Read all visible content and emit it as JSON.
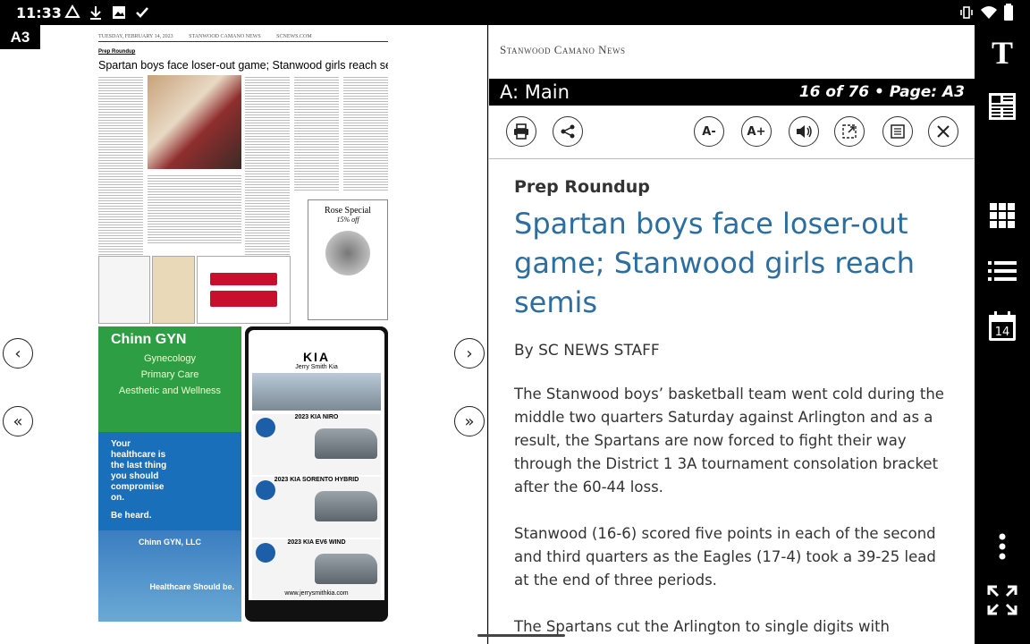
{
  "status_bar": {
    "time": "11:33"
  },
  "left_pane": {
    "page_badge": "A3",
    "paper": {
      "masthead_date": "TUESDAY, FEBRUARY 14, 2023",
      "masthead_pub": "STANWOOD CAMANO NEWS",
      "masthead_site": "SCNEWS.COM",
      "section_label": "Prep Roundup",
      "headline": "Spartan boys face loser-out game; Stanwood girls reach semis",
      "rose_title": "Rose Special",
      "rose_offer": "15% off",
      "chinn_title": "Chinn GYN",
      "chinn_services": [
        "Gynecology",
        "Primary Care",
        "Aesthetic and Wellness"
      ],
      "chinn_blue_text": "Your healthcare is the last thing you should compromise on.",
      "chinn_blue_sub": "Be heard.",
      "chinn_llc": "Chinn GYN, LLC",
      "chinn_tag": "Healthcare Should be.",
      "kia_brand": "KIA",
      "kia_dealer": "Jerry Smith Kia",
      "kia_models": [
        "2023 KIA NIRO",
        "2023 KIA SORENTO HYBRID",
        "2023 KIA EV6 WIND"
      ],
      "kia_site": "www.jerrysmithkia.com"
    }
  },
  "right_pane": {
    "publication": "Stanwood Camano News",
    "section": "A: Main",
    "position": "16 of 76 • Page: A3",
    "toolbar": {
      "print": "print-icon",
      "share": "share-icon",
      "font_smaller": "A-",
      "font_larger": "A+",
      "audio": "speaker-icon",
      "view_page": "page-icon",
      "text_view": "article-icon",
      "close": "close-icon"
    },
    "article": {
      "kicker": "Prep Roundup",
      "headline": "Spartan boys face loser-out game; Stanwood girls reach semis",
      "byline": "By SC NEWS STAFF",
      "paragraphs": [
        "The Stanwood boys’ basketball team went cold during the middle two quarters Saturday against Arlington and as a result, the Spartans are now forced to fight their way through the District 1 3A tournament consolation bracket after the 60-44 loss.",
        "Stanwood (16-6) scored five points in each of the second and third quarters as the Eagles (17-4) took a 39-25 lead at the end of three periods.",
        "The Spartans cut the Arlington to single digits with"
      ]
    }
  },
  "right_rail": {
    "text_size_label": "T",
    "calendar_day": "14"
  }
}
